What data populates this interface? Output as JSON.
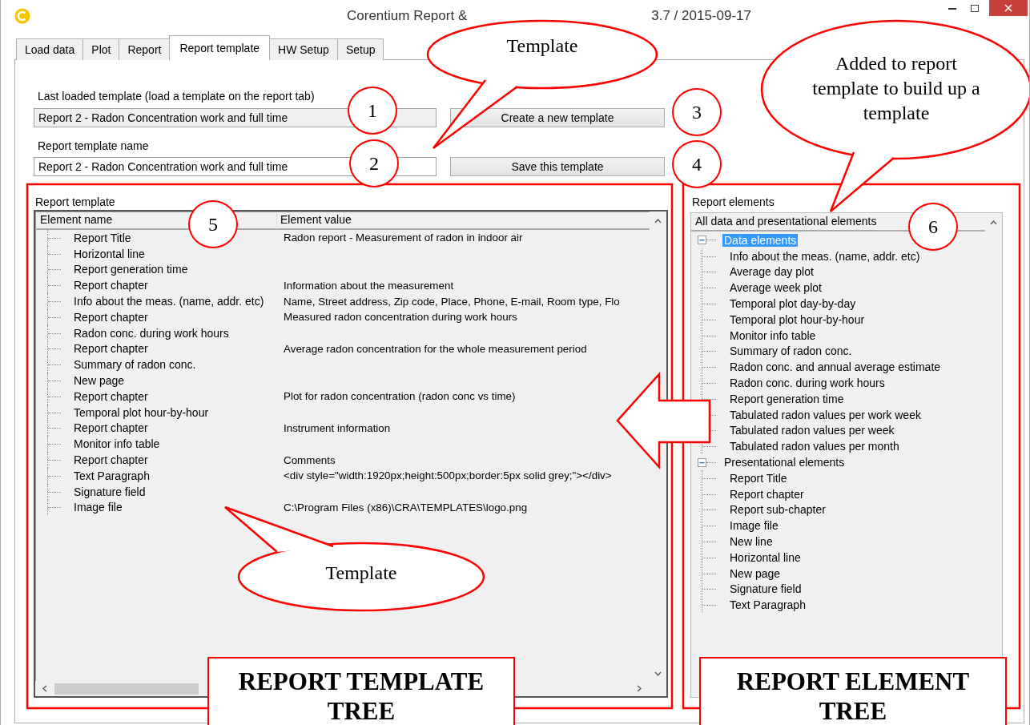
{
  "window": {
    "title_parts": [
      "Corentium Report &",
      "3.7 / 2015-09-17"
    ]
  },
  "tabs": [
    {
      "label": "Load data",
      "selected": false
    },
    {
      "label": "Plot",
      "selected": false
    },
    {
      "label": "Report",
      "selected": false
    },
    {
      "label": "Report template",
      "selected": true
    },
    {
      "label": "HW Setup",
      "selected": false
    },
    {
      "label": "Setup",
      "selected": false
    }
  ],
  "last_loaded": {
    "label": "Last loaded template (load a template on the report tab)",
    "value": "Report 2 - Radon Concentration work and full time"
  },
  "template_name": {
    "label": "Report template name",
    "value": "Report 2 - Radon Concentration work and full time"
  },
  "buttons": [
    "Create a new template",
    "Save this template"
  ],
  "report_template": {
    "title": "Report template",
    "columns": [
      "Element name",
      "Element value"
    ],
    "rows": [
      {
        "name": "Report Title",
        "value": "Radon report - Measurement of radon in indoor air"
      },
      {
        "name": "Horizontal line"
      },
      {
        "name": "Report generation time"
      },
      {
        "name": "Report chapter",
        "value": "Information about the measurement"
      },
      {
        "name": "Info about the meas. (name, addr. etc)",
        "value": "Name, Street address, Zip code, Place, Phone, E-mail, Room type, Flo"
      },
      {
        "name": "Report chapter",
        "value": "Measured radon concentration during work hours"
      },
      {
        "name": "Radon conc. during work hours"
      },
      {
        "name": "Report chapter",
        "value": "Average radon concentration for the whole measurement period"
      },
      {
        "name": "Summary of radon conc."
      },
      {
        "name": "New page"
      },
      {
        "name": "Report chapter",
        "value": "Plot for radon concentration (radon conc vs time)"
      },
      {
        "name": "Temporal plot hour-by-hour"
      },
      {
        "name": "Report chapter",
        "value": "Instrument information"
      },
      {
        "name": "Monitor info table"
      },
      {
        "name": "Report chapter",
        "value": "Comments"
      },
      {
        "name": "Text Paragraph",
        "value": "<div style=\"width:1920px;height:500px;border:5px solid grey;\"></div>"
      },
      {
        "name": "Signature field"
      },
      {
        "name": "Image file",
        "value": "C:\\Program Files (x86)\\CRA\\TEMPLATES\\logo.png"
      }
    ]
  },
  "report_elements": {
    "title": "Report elements",
    "header": "All data and presentational elements",
    "tree": [
      {
        "label": "Data elements",
        "expanded": true,
        "selected": true,
        "children": [
          {
            "label": "Info about the meas. (name, addr. etc)",
            "selected": false
          },
          {
            "label": "Average day plot",
            "selected": false
          },
          {
            "label": "Average week plot",
            "selected": false
          },
          {
            "label": "Temporal plot day-by-day",
            "selected": false
          },
          {
            "label": "Temporal plot hour-by-hour",
            "selected": false
          },
          {
            "label": "Monitor info table",
            "selected": false
          },
          {
            "label": "Summary of radon conc.",
            "selected": false
          },
          {
            "label": "Radon conc. and annual average estimate",
            "selected": false
          },
          {
            "label": "Radon conc. during work hours",
            "selected": false
          },
          {
            "label": "Report generation time",
            "selected": false
          },
          {
            "label": "Tabulated radon values per work week",
            "selected": false
          },
          {
            "label": "Tabulated radon values per week",
            "selected": false
          },
          {
            "label": "Tabulated radon values per month",
            "selected": false
          }
        ]
      },
      {
        "label": "Presentational elements",
        "expanded": true,
        "selected": false,
        "children": [
          {
            "label": "Report Title",
            "selected": false
          },
          {
            "label": "Report chapter",
            "selected": false
          },
          {
            "label": "Report sub-chapter",
            "selected": false
          },
          {
            "label": "Image file",
            "selected": false
          },
          {
            "label": "New line",
            "selected": false
          },
          {
            "label": "Horizontal line",
            "selected": false
          },
          {
            "label": "New page",
            "selected": false
          },
          {
            "label": "Signature field",
            "selected": false
          },
          {
            "label": "Text Paragraph",
            "selected": false
          }
        ]
      }
    ]
  },
  "annotations": {
    "callouts": [
      "Template",
      "Added to report template to build up a template",
      "Template"
    ],
    "markers": [
      "1",
      "2",
      "3",
      "4",
      "5",
      "6"
    ],
    "captions": [
      "REPORT TEMPLATE TREE",
      "REPORT ELEMENT TREE"
    ]
  }
}
